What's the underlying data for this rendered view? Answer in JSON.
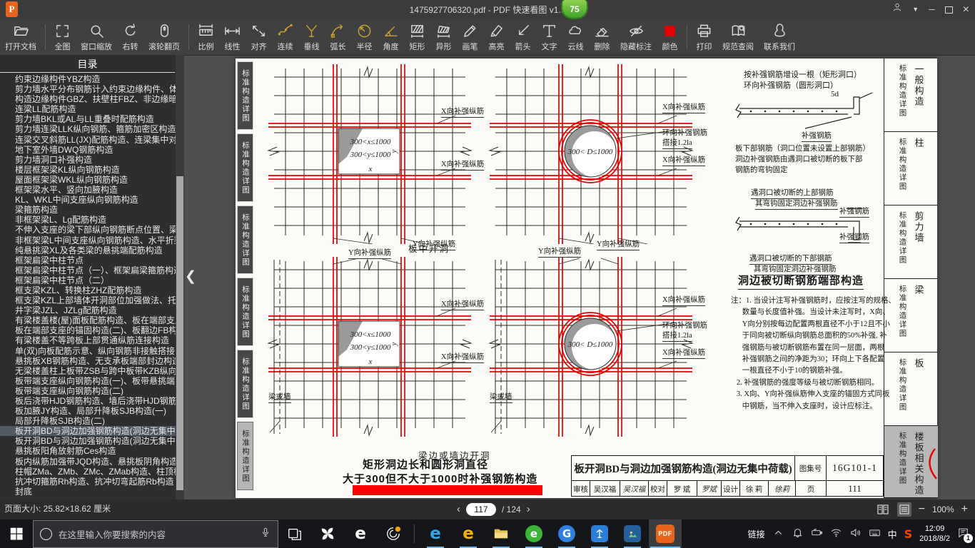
{
  "title_bar": {
    "logo_glyph": "P",
    "title": "1475927706320.pdf - PDF 快速看图 v1.9",
    "badge": "75",
    "controls": {
      "dropdown": "▼",
      "minimize": "─",
      "close": "×"
    }
  },
  "toolbar": {
    "items": [
      {
        "label": "打开文档",
        "icon": "open-folder-icon"
      },
      {
        "label": "全图",
        "icon": "fit-screen-icon"
      },
      {
        "label": "窗口缩放",
        "icon": "window-zoom-icon"
      },
      {
        "label": "右转",
        "icon": "rotate-right-icon"
      },
      {
        "label": "滚轮翻页",
        "icon": "scroll-wheel-icon"
      },
      {
        "label": "比例",
        "icon": "scale-ruler-icon"
      },
      {
        "label": "线性",
        "icon": "linear-measure-icon"
      },
      {
        "label": "对齐",
        "icon": "align-measure-icon"
      },
      {
        "label": "连续",
        "icon": "polyline-measure-icon",
        "accent": true
      },
      {
        "label": "垂线",
        "icon": "perpendicular-icon",
        "accent": true
      },
      {
        "label": "弧长",
        "icon": "arc-length-icon",
        "accent": true
      },
      {
        "label": "半径",
        "icon": "radius-icon",
        "accent": true
      },
      {
        "label": "角度",
        "icon": "angle-icon",
        "accent": true
      },
      {
        "label": "矩形",
        "icon": "rect-area-icon"
      },
      {
        "label": "异形",
        "icon": "polygon-area-icon"
      },
      {
        "label": "画笔",
        "icon": "pen-icon"
      },
      {
        "label": "高亮",
        "icon": "highlighter-icon"
      },
      {
        "label": "箭头",
        "icon": "arrow-icon"
      },
      {
        "label": "文字",
        "icon": "text-icon"
      },
      {
        "label": "云线",
        "icon": "cloud-line-icon"
      },
      {
        "label": "删除",
        "icon": "eraser-icon"
      },
      {
        "label": "隐藏标注",
        "icon": "hide-annotations-icon"
      },
      {
        "label": "颜色",
        "icon": "color-swatch",
        "color": "#e80000"
      },
      {
        "label": "打印",
        "icon": "printer-icon"
      },
      {
        "label": "规范查阅",
        "icon": "standards-book-icon"
      },
      {
        "label": "联系我们",
        "icon": "contact-icon"
      }
    ]
  },
  "sidebar": {
    "header": "目录",
    "items": [
      {
        "label": "约束边缘构件YBZ构造"
      },
      {
        "label": "剪力墙水平分布钢筋计入约束边缘构件、体积配箍率"
      },
      {
        "label": "构造边缘构件GBZ、扶壁柱FBZ、非边缘暗柱构造"
      },
      {
        "label": "连梁LL配筋构造"
      },
      {
        "label": "剪力墙BKL或AL与LL重叠时配筋构造"
      },
      {
        "label": "剪力墙连梁LLK纵向钢筋、箍筋加密区构造"
      },
      {
        "label": "连梁交叉斜筋LL(JX)配筋构造、连梁集中对角斜筋"
      },
      {
        "label": "地下室外墙DWQ钢筋构造"
      },
      {
        "label": "剪力墙洞口补强构造"
      },
      {
        "label": "楼层框架梁KL纵向钢筋构造"
      },
      {
        "label": "屋面框架梁WKL纵向钢筋构造"
      },
      {
        "label": "框架梁水平、竖向加腋构造"
      },
      {
        "label": "KL、WKL中间支座纵向钢筋构造"
      },
      {
        "label": "梁箍筋构造"
      },
      {
        "label": "非框架梁L、Lg配筋构造"
      },
      {
        "label": "不伸入支座的梁下部纵向钢筋断点位置、梁"
      },
      {
        "label": "非框架梁L中间支座纵向钢筋构造、水平折梁"
      },
      {
        "label": "纯悬挑梁XL及各类梁的悬挑端配筋构造"
      },
      {
        "label": "框架扁梁中柱节点"
      },
      {
        "label": "框架扁梁中柱节点（一）、框架扁梁箍筋构造"
      },
      {
        "label": "框架扁梁中柱节点（二）"
      },
      {
        "label": "框支梁KZL、转换柱ZHZ配筋构造"
      },
      {
        "label": "框支梁KZL上部墙体开洞部位加强做法、托柱"
      },
      {
        "label": "井字梁JZL、JZLg配筋构造"
      },
      {
        "label": "有梁楼盖楼(屋)面板配筋构造、板在端部支座"
      },
      {
        "label": "板在端部支座的锚固构造(二)、板翻边FB构造"
      },
      {
        "label": "有梁楼盖不等跨板上部贯通纵筋连接构造"
      },
      {
        "label": "单(双)向板配筋示意、纵向钢筋非接触搭接"
      },
      {
        "label": "悬挑板XB钢筋构造、无支承板端部封边构造"
      },
      {
        "label": "无梁楼盖柱上板带ZSB与跨中板带KZB纵向钢"
      },
      {
        "label": "板带端支座纵向钢筋构造(一)、板带悬挑端"
      },
      {
        "label": "板带端支座纵向钢筋构造(二)"
      },
      {
        "label": "板后浇带HJD钢筋构造、墙后浇带HJD钢筋构"
      },
      {
        "label": "板加腋JY构造、局部升降板SJB构造(一)"
      },
      {
        "label": "局部升降板SJB构造(二)"
      },
      {
        "label": "板开洞BD与洞边加强钢筋构造(洞边无集中",
        "active": true
      },
      {
        "label": "板开洞BD与洞边加强钢筋构造(洞边无集中"
      },
      {
        "label": "悬挑板阳角放射筋Ces构造"
      },
      {
        "label": "板内纵筋加强带JQD构造、悬挑板阴角构造"
      },
      {
        "label": "柱帽ZMa、ZMb、ZMc、ZMab构造、柱顶柱帽"
      },
      {
        "label": "抗冲切箍筋Rh构造、抗冲切弯起筋Rb构造"
      },
      {
        "label": "封底"
      }
    ]
  },
  "collapse_arrow": "❮",
  "page": {
    "left_tabs": [
      "标准构造详图",
      "标准构造详图",
      "标准构造详图",
      "标准构造详图",
      "标准构造详图",
      "标准构造详图"
    ],
    "right_tabs": [
      {
        "main": "标准构造详图",
        "cat": "一般构造"
      },
      {
        "main": "标准构造详图",
        "cat": "柱"
      },
      {
        "main": "标准构造详图",
        "cat": "剪力墙"
      },
      {
        "main": "标准构造详图",
        "cat": "梁"
      },
      {
        "main": "标准构造详图",
        "cat": "板"
      },
      {
        "main": "标准构造详图",
        "cat": "楼板相关构造",
        "active": true
      }
    ],
    "fig_texts": {
      "rect_line1": "300<x≤1000",
      "rect_line2": "300<y≤1000",
      "circle_line": "300< D≤1000",
      "dim_x": "x",
      "dim_y": "y"
    },
    "labels": {
      "tl_x_top": "X向补强纵筋",
      "tl_x_bot": "X向补强纵筋",
      "tl_y": "Y向补强纵筋",
      "cap_top": "板中开洞",
      "tr_x_top": "X向补强纵筋",
      "tr_ring": "环向补强钢筋",
      "tr_lap": "搭接1.2la",
      "tr_x_bot": "X向补强纵筋",
      "tr_y": "Y向补强纵筋",
      "bl_y": "Y向补强纵筋",
      "bl_x_top": "X向补强纵筋",
      "bl_x_bot": "X向补强纵筋",
      "bl_wall": "梁或墙",
      "br_y": "Y向补强纵筋",
      "br_x_top": "X向补强纵筋",
      "br_ring": "环向补强钢筋",
      "br_lap": "搭接1.2la",
      "br_x_bot": "X向补强纵筋",
      "br_wall": "梁或墙",
      "cap_bot": "梁边或墙边开洞",
      "title1": "矩形洞边长和圆形洞直径",
      "title2": "大于300但不大于1000时补强钢筋构造"
    },
    "right_column": {
      "ann1": "按补强钢筋增设一根（矩形洞口）",
      "ann2": "环向补强钢筋（圆形洞口）",
      "dim_5d": "5d",
      "bq1": "补强钢筋",
      "p1": "板下部钢筋（洞口位置未设置上部钢筋）",
      "p2": "洞边补强钢筋由遇洞口被切断的板下部",
      "p3": "钢筋的弯钩固定",
      "u1": "遇洞口被切断的上部钢筋",
      "u2": "其弯钩固定洞边补强钢筋",
      "bq2": "补强钢筋",
      "bq3": "补强钢筋",
      "d1": "遇洞口被切断的下部钢筋",
      "d2": "其弯钩固定洞边补强钢筋",
      "heading": "洞边被切断钢筋端部构造",
      "notes": [
        "注：1. 当设计注写补强钢筋时，应按注写的规格、",
        "      数量与长度值补强。当设计未注写时，X向、",
        "      Y向分别按每边配置两根直径不小于12且不小",
        "      于同向被切断纵向钢筋总面积的50%补强, 补",
        "      强钢筋与被切断钢筋布置在同一层面，两根",
        "      补强钢筋之间的净距为30；环向上下各配置",
        "      一根直径不小于10的钢筋补强。",
        "   2. 补强钢筋的强度等级与被切断钢筋相同。",
        "   3. X向、Y向补强纵筋伸入支座的锚固方式同板",
        "      中钢筋，当不伸入支座时，设计应标注。"
      ]
    },
    "title_block": {
      "name": "板开洞BD与洞边加强钢筋构造(洞边无集中荷载)",
      "fig_label": "图集号",
      "fig_no": "16G101-1",
      "page_label": "页",
      "page_no": "111",
      "row2": [
        "审核",
        "吴汉福",
        "吴汉福",
        "校对",
        "罗 斌",
        "罗斌",
        "设计",
        "徐 莉",
        "徐莉"
      ]
    }
  },
  "status_bar": {
    "size_label": "页面大小: 25.82×18.62 厘米",
    "prev": "‹",
    "next": "›",
    "page_current": "117",
    "page_total": "/ 124",
    "zoom_out": "−",
    "zoom_value": "100%",
    "zoom_in": "+"
  },
  "taskbar": {
    "search_placeholder": "在这里输入你要搜索的内容",
    "apps": [
      {
        "name": "task-view",
        "icon": "taskview"
      },
      {
        "name": "pinwheel-app",
        "icon": "pinwheel"
      },
      {
        "name": "ie-white",
        "icon": "e-plain",
        "glyph": "e",
        "color": "#ffffff"
      },
      {
        "name": "update-notifier",
        "icon": "swirl-bell"
      },
      {
        "name": "separator"
      },
      {
        "name": "ie-blue",
        "icon": "e-plain",
        "glyph": "e",
        "color": "#2fa7e8",
        "running": true
      },
      {
        "name": "maxthon-browser",
        "icon": "e-plain",
        "glyph": "e",
        "color": "#f0b400",
        "running": true
      },
      {
        "name": "file-explorer",
        "icon": "folder",
        "running": true
      },
      {
        "name": "green-browser",
        "icon": "circle-glyph",
        "glyph": "e",
        "color": "#3cb43a",
        "running": true
      },
      {
        "name": "g-browser",
        "icon": "circle-glyph",
        "glyph": "G",
        "color": "#2f7ee0",
        "running": true
      },
      {
        "name": "blue-tool",
        "icon": "blue-app",
        "running": true
      },
      {
        "name": "photo-viewer",
        "icon": "photos",
        "running": true
      },
      {
        "name": "pdf-reader",
        "icon": "pdf",
        "glyph": "PDF",
        "running": true,
        "active": true
      }
    ],
    "tray": {
      "link_label": "链接",
      "ime": "中",
      "sogou": "S",
      "clock_time": "12:09",
      "clock_date": "2018/8/2",
      "notif_badge": "1"
    }
  }
}
